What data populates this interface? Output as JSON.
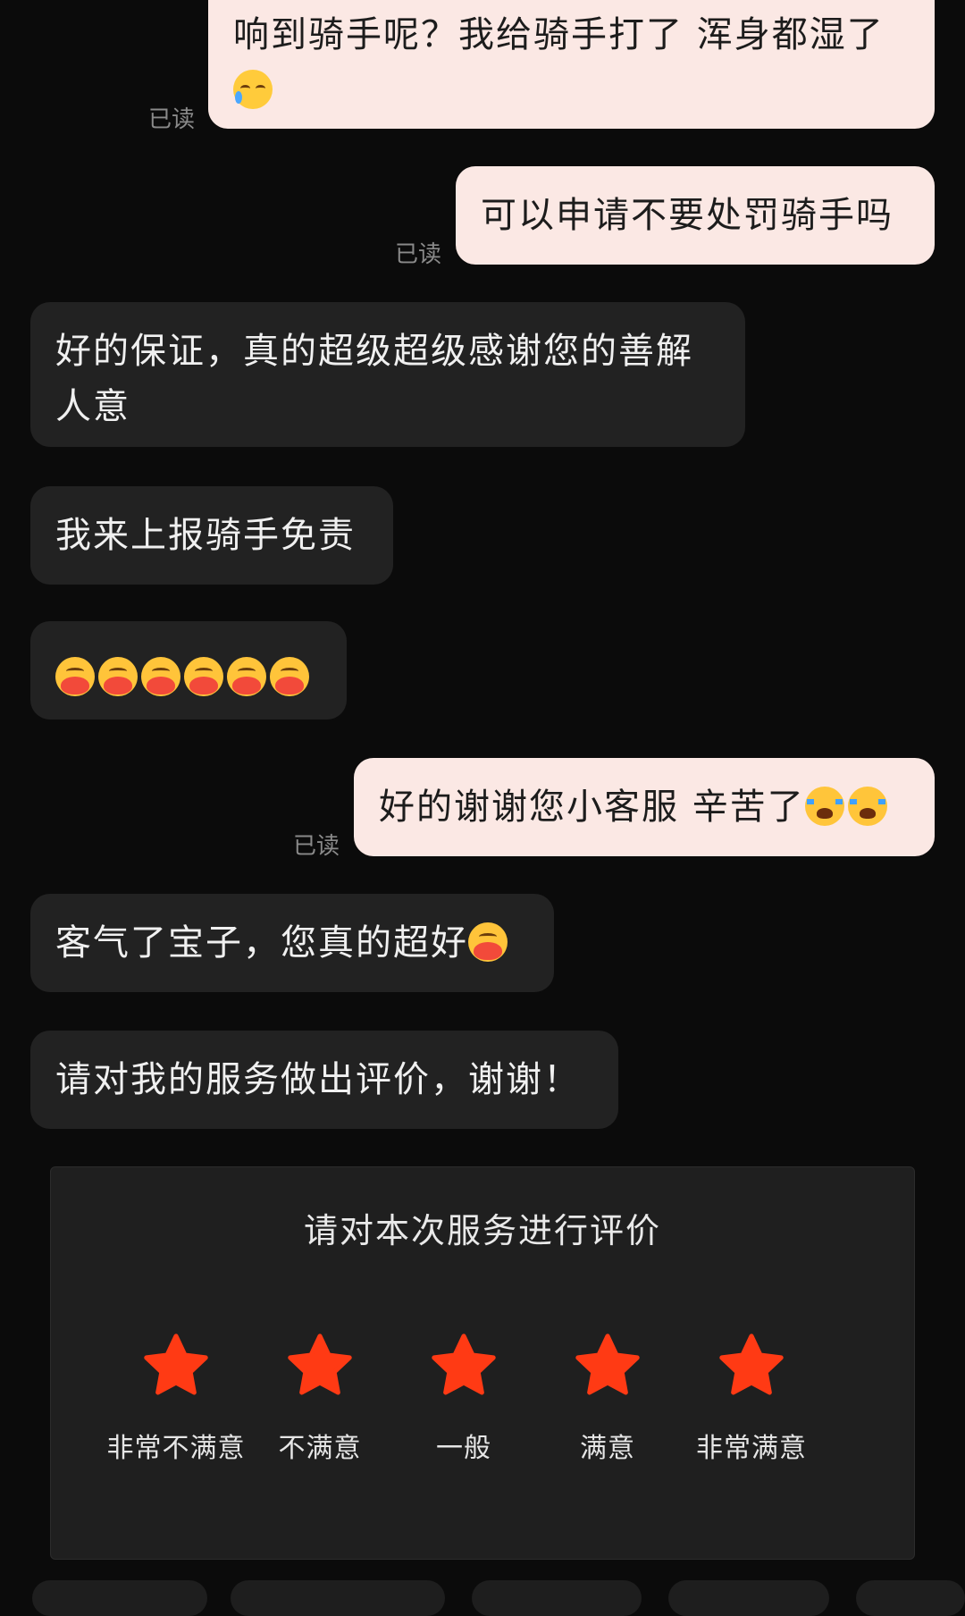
{
  "messages": [
    {
      "id": "m1",
      "side": "out",
      "text": "响到骑手呢？我给骑手打了 浑身都湿了",
      "emoji": [
        "sad"
      ],
      "read": "已读"
    },
    {
      "id": "m2",
      "side": "out",
      "text": "可以申请不要处罚骑手吗",
      "emoji": [],
      "read": "已读"
    },
    {
      "id": "m3",
      "side": "in",
      "text": "好的保证，真的超级超级感谢您的善解人意",
      "emoji": []
    },
    {
      "id": "m4",
      "side": "in",
      "text": "我来上报骑手免责",
      "emoji": []
    },
    {
      "id": "m5",
      "side": "in",
      "text": "",
      "emoji": [
        "hug",
        "hug",
        "hug",
        "hug",
        "hug",
        "hug"
      ]
    },
    {
      "id": "m6",
      "side": "out",
      "text": "好的谢谢您小客服 辛苦了",
      "emoji": [
        "cry",
        "cry"
      ],
      "read": "已读"
    },
    {
      "id": "m7",
      "side": "in",
      "text": "客气了宝子，您真的超好",
      "emoji": [
        "hug"
      ]
    },
    {
      "id": "m8",
      "side": "in",
      "text": "请对我的服务做出评价，谢谢！",
      "emoji": []
    }
  ],
  "rating": {
    "title": "请对本次服务进行评价",
    "star_color": "#ff3a14",
    "options": [
      "非常不满意",
      "不满意",
      "一般",
      "满意",
      "非常满意"
    ]
  },
  "colors": {
    "background": "#0b0b0b",
    "outgoing_bubble": "#fbe8e4",
    "incoming_bubble": "#222222"
  }
}
